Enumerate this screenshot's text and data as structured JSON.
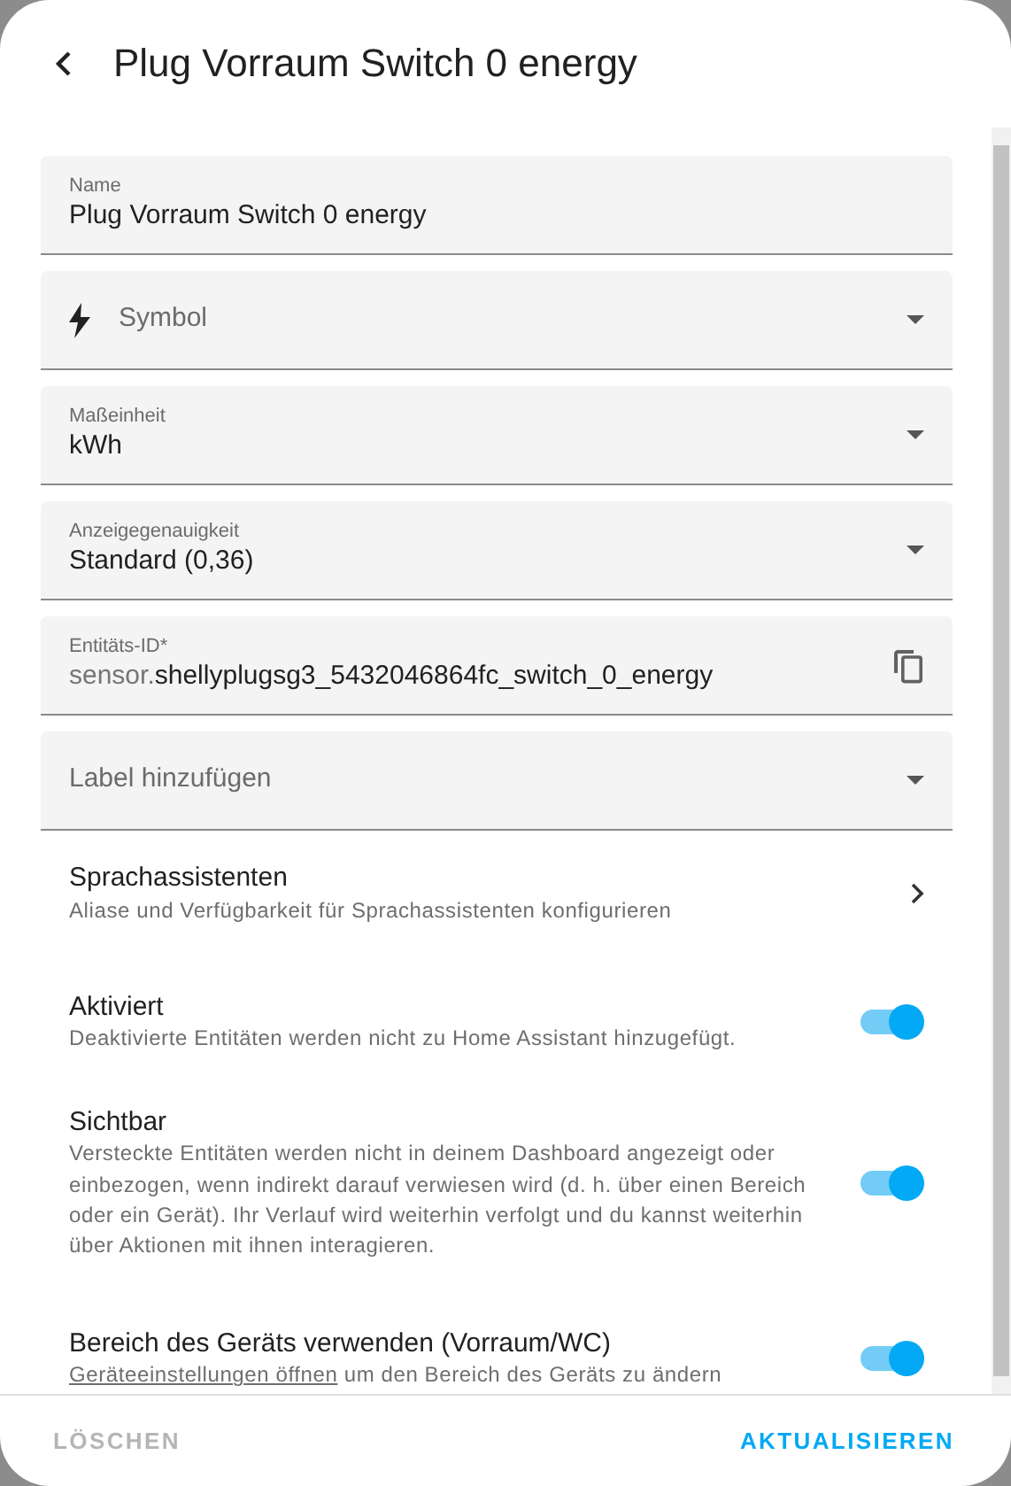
{
  "header": {
    "title": "Plug Vorraum Switch 0 energy"
  },
  "fields": [
    {
      "kind": "text",
      "label": "Name",
      "value": "Plug Vorraum Switch 0 energy"
    },
    {
      "kind": "icon_select",
      "placeholder": "Symbol"
    },
    {
      "kind": "select",
      "label": "Maßeinheit",
      "value": "kWh"
    },
    {
      "kind": "select",
      "label": "Anzeigegenauigkeit",
      "value": "Standard (0,36)"
    },
    {
      "kind": "entity_id",
      "label": "Entitäts-ID*",
      "prefix": "sensor.",
      "value": "shellyplugsg3_5432046864fc_switch_0_energy"
    },
    {
      "kind": "select",
      "placeholder": "Label hinzufügen"
    }
  ],
  "rows": [
    {
      "kind": "link",
      "title": "Sprachassistenten",
      "description": "Aliase und Verfügbarkeit für Sprachassistenten konfigurieren"
    },
    {
      "kind": "toggle",
      "title": "Aktiviert",
      "description": "Deaktivierte Entitäten werden nicht zu Home Assistant hinzugefügt.",
      "on": true
    },
    {
      "kind": "toggle",
      "title": "Sichtbar",
      "description": "Versteckte Entitäten werden nicht in deinem Dashboard angezeigt oder einbezogen, wenn indirekt darauf verwiesen wird (d. h. über einen Bereich oder ein Gerät). Ihr Verlauf wird weiterhin verfolgt und du kannst weiterhin über Aktionen mit ihnen interagieren.",
      "on": true
    },
    {
      "kind": "toggle",
      "title": "Bereich des Geräts verwenden (Vorraum/WC)",
      "description_link": "Geräteeinstellungen öffnen",
      "description": "um den Bereich des Geräts zu ändern",
      "on": true
    }
  ],
  "footer": {
    "buttons": [
      {
        "label": "LÖSCHEN",
        "disabled": true
      },
      {
        "label": "AKTUALISIEREN",
        "disabled": false
      }
    ]
  }
}
